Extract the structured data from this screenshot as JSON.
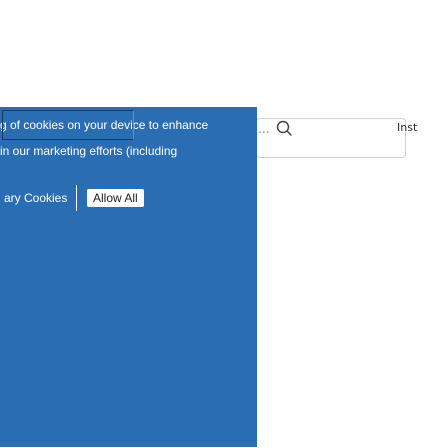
{
  "search": {
    "ellipsis": "...",
    "icon": "search-icon"
  },
  "nav": {
    "insta_label": "Inst"
  },
  "cookie_banner": {
    "line1": "g of cookies on your device to enhance",
    "line2": "in our marketing efforts (including",
    "necessary_label": "ary Cookies",
    "allow_all_label": "Allow All",
    "background_color": "#2b6db2"
  }
}
